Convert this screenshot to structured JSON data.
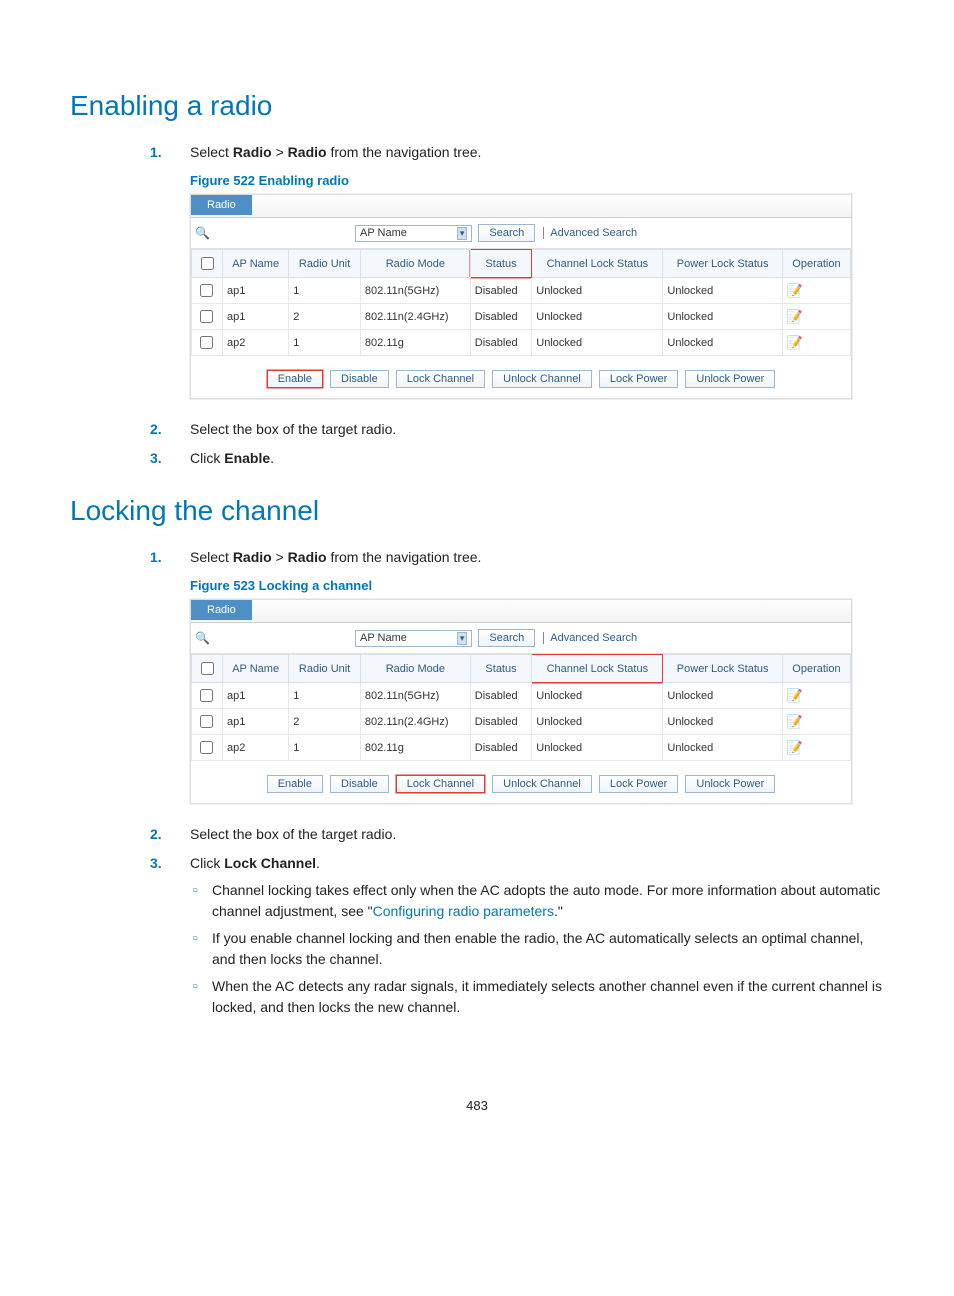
{
  "heading1": "Enabling a radio",
  "heading2": "Locking the channel",
  "steps1": {
    "s1_pre": "Select ",
    "s1_b1": "Radio",
    "s1_mid": " > ",
    "s1_b2": "Radio",
    "s1_post": " from the navigation tree.",
    "s2": "Select the box of the target radio.",
    "s3_pre": "Click ",
    "s3_b": "Enable",
    "s3_post": "."
  },
  "steps2": {
    "s1_pre": "Select ",
    "s1_b1": "Radio",
    "s1_mid": " > ",
    "s1_b2": "Radio",
    "s1_post": " from the navigation tree.",
    "s2": "Select the box of the target radio.",
    "s3_pre": "Click ",
    "s3_b": "Lock Channel",
    "s3_post": ".",
    "bul1_pre": "Channel locking takes effect only when the AC adopts the auto mode. For more information about automatic channel adjustment, see \"",
    "bul1_link": "Configuring radio parameters",
    "bul1_post": ".\"",
    "bul2": "If you enable channel locking and then enable the radio, the AC automatically selects an optimal channel, and then locks the channel.",
    "bul3": "When the AC detects any radar signals, it immediately selects another channel even if the current channel is locked, and then locks the new channel."
  },
  "fig1_caption": "Figure 522 Enabling radio",
  "fig2_caption": "Figure 523 Locking a channel",
  "ui": {
    "tab": "Radio",
    "select_label": "AP Name",
    "search_btn": "Search",
    "advanced": "Advanced Search",
    "headers": {
      "apname": "AP Name",
      "radiounit": "Radio Unit",
      "radiomode": "Radio Mode",
      "status": "Status",
      "chlock": "Channel Lock Status",
      "pwlock": "Power Lock Status",
      "operation": "Operation"
    },
    "rows": [
      {
        "ap": "ap1",
        "unit": "1",
        "mode": "802.11n(5GHz)",
        "status": "Disabled",
        "ch": "Unlocked",
        "pw": "Unlocked"
      },
      {
        "ap": "ap1",
        "unit": "2",
        "mode": "802.11n(2.4GHz)",
        "status": "Disabled",
        "ch": "Unlocked",
        "pw": "Unlocked"
      },
      {
        "ap": "ap2",
        "unit": "1",
        "mode": "802.11g",
        "status": "Disabled",
        "ch": "Unlocked",
        "pw": "Unlocked"
      }
    ],
    "actions": {
      "enable": "Enable",
      "disable": "Disable",
      "lockch": "Lock Channel",
      "unlockch": "Unlock Channel",
      "lockpw": "Lock Power",
      "unlockpw": "Unlock Power"
    }
  },
  "pageno": "483"
}
